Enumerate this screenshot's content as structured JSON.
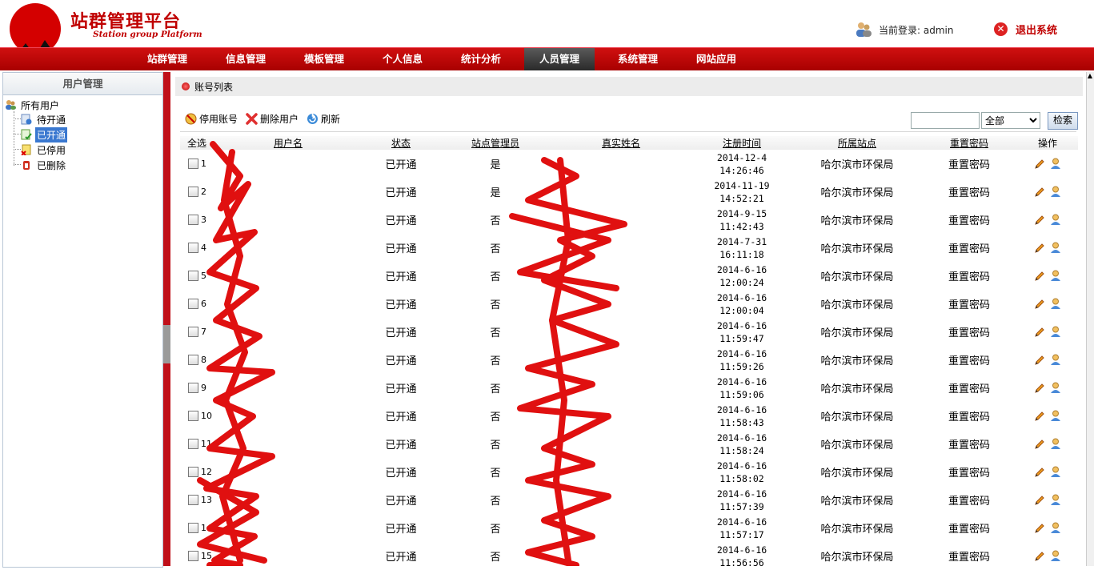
{
  "header": {
    "brand_cn": "站群管理平台",
    "brand_en": "Station group Platform",
    "login_text": "当前登录: admin",
    "logout_label": "退出系统",
    "logo_icon": "mountain-logo-icon",
    "user_icon": "users-icon",
    "logout_icon": "close-circle-icon"
  },
  "nav": {
    "items": [
      "站群管理",
      "信息管理",
      "模板管理",
      "个人信息",
      "统计分析",
      "人员管理",
      "系统管理",
      "网站应用"
    ],
    "active": "人员管理"
  },
  "sidebar": {
    "title": "用户管理",
    "root_label": "所有用户",
    "nodes": [
      "待开通",
      "已开通",
      "已停用",
      "已删除"
    ],
    "selected": "已开通"
  },
  "main": {
    "panel_title": "账号列表",
    "toolbar": {
      "disable_label": "停用账号",
      "delete_label": "删除用户",
      "refresh_label": "刷新"
    },
    "search": {
      "input_value": "",
      "status_value": "全部",
      "button_label": "检索"
    },
    "columns": [
      "全选",
      "用户名",
      "状态",
      "站点管理员",
      "真实姓名",
      "注册时间",
      "所属站点",
      "重置密码",
      "操作"
    ],
    "rows": [
      {
        "index": "1",
        "status": "已开通",
        "admin": "是",
        "date": "2014-12-4",
        "time": "14:26:46",
        "site": "哈尔滨市环保局",
        "reset": "重置密码"
      },
      {
        "index": "2",
        "status": "已开通",
        "admin": "是",
        "date": "2014-11-19",
        "time": "14:52:21",
        "site": "哈尔滨市环保局",
        "reset": "重置密码"
      },
      {
        "index": "3",
        "status": "已开通",
        "admin": "否",
        "date": "2014-9-15",
        "time": "11:42:43",
        "site": "哈尔滨市环保局",
        "reset": "重置密码"
      },
      {
        "index": "4",
        "status": "已开通",
        "admin": "否",
        "date": "2014-7-31",
        "time": "16:11:18",
        "site": "哈尔滨市环保局",
        "reset": "重置密码"
      },
      {
        "index": "5",
        "status": "已开通",
        "admin": "否",
        "date": "2014-6-16",
        "time": "12:00:24",
        "site": "哈尔滨市环保局",
        "reset": "重置密码"
      },
      {
        "index": "6",
        "status": "已开通",
        "admin": "否",
        "date": "2014-6-16",
        "time": "12:00:04",
        "site": "哈尔滨市环保局",
        "reset": "重置密码"
      },
      {
        "index": "7",
        "status": "已开通",
        "admin": "否",
        "date": "2014-6-16",
        "time": "11:59:47",
        "site": "哈尔滨市环保局",
        "reset": "重置密码"
      },
      {
        "index": "8",
        "status": "已开通",
        "admin": "否",
        "date": "2014-6-16",
        "time": "11:59:26",
        "site": "哈尔滨市环保局",
        "reset": "重置密码"
      },
      {
        "index": "9",
        "status": "已开通",
        "admin": "否",
        "date": "2014-6-16",
        "time": "11:59:06",
        "site": "哈尔滨市环保局",
        "reset": "重置密码"
      },
      {
        "index": "10",
        "status": "已开通",
        "admin": "否",
        "date": "2014-6-16",
        "time": "11:58:43",
        "site": "哈尔滨市环保局",
        "reset": "重置密码"
      },
      {
        "index": "11",
        "status": "已开通",
        "admin": "否",
        "date": "2014-6-16",
        "time": "11:58:24",
        "site": "哈尔滨市环保局",
        "reset": "重置密码"
      },
      {
        "index": "12",
        "status": "已开通",
        "admin": "否",
        "date": "2014-6-16",
        "time": "11:58:02",
        "site": "哈尔滨市环保局",
        "reset": "重置密码"
      },
      {
        "index": "13",
        "status": "已开通",
        "admin": "否",
        "date": "2014-6-16",
        "time": "11:57:39",
        "site": "哈尔滨市环保局",
        "reset": "重置密码"
      },
      {
        "index": "14",
        "status": "已开通",
        "admin": "否",
        "date": "2014-6-16",
        "time": "11:57:17",
        "site": "哈尔滨市环保局",
        "reset": "重置密码"
      },
      {
        "index": "15",
        "status": "已开通",
        "admin": "否",
        "date": "2014-6-16",
        "time": "11:56:56",
        "site": "哈尔滨市环保局",
        "reset": "重置密码"
      }
    ]
  },
  "colors": {
    "brand_red": "#c00000",
    "nav_red": "#c00000",
    "nav_active": "#3a3a3a",
    "selection_blue": "#3a78d0",
    "redaction_red": "#e01010"
  }
}
